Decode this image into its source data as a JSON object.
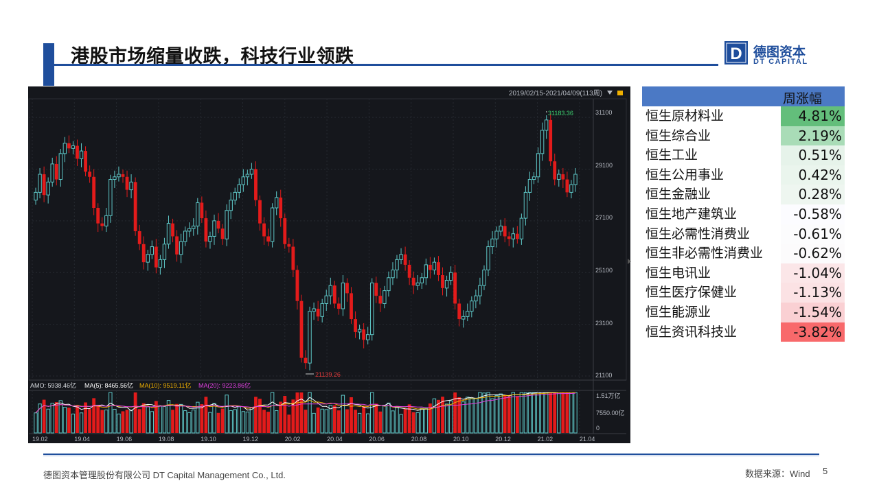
{
  "header": {
    "title": "港股市场缩量收跌，科技行业领跌"
  },
  "logo": {
    "cn": "德图资本",
    "en": "DT CAPITAL",
    "mark": "D"
  },
  "chart": {
    "date_range": "2019/02/15-2021/04/09(113周)",
    "max_label": "31183.36",
    "min_label": "21139.26",
    "price_ticks": [
      "31100",
      "29100",
      "27100",
      "25100",
      "23100",
      "21100"
    ],
    "amo_label": "AMO: 5938.46亿",
    "ma5_label": "MA(5): 8465.56亿",
    "ma10_label": "MA(10): 9519.11亿",
    "ma20_label": "MA(20): 9223.86亿",
    "vol_ticks": [
      "1.51万亿",
      "7550.00亿",
      "0"
    ],
    "x_labels": [
      "19.02",
      "19.04",
      "19.06",
      "19.08",
      "19.10",
      "19.12",
      "20.02",
      "20.04",
      "20.06",
      "20.08",
      "20.10",
      "20.12",
      "21.02",
      "21.04"
    ],
    "colors": {
      "up": "#5ec7c7",
      "down": "#e31b1b",
      "bg": "#15171c",
      "ma5": "#ffffff",
      "ma10": "#f0b000",
      "ma20": "#e040e0"
    }
  },
  "chart_data": {
    "type": "candlestick",
    "title": "",
    "ylim": [
      21100,
      31500
    ],
    "closes": [
      28200,
      28900,
      28100,
      28600,
      29300,
      28700,
      29700,
      30100,
      29900,
      30000,
      29500,
      29800,
      29000,
      28800,
      27600,
      27000,
      26900,
      27300,
      28700,
      28800,
      28900,
      28800,
      28300,
      28600,
      26700,
      26200,
      25500,
      25800,
      26100,
      25300,
      25600,
      26200,
      27000,
      26500,
      25800,
      26300,
      26700,
      26800,
      26900,
      27800,
      27200,
      26300,
      26500,
      27100,
      26800,
      26400,
      27500,
      27900,
      28200,
      28500,
      28800,
      28900,
      29100,
      27900,
      27000,
      26500,
      26300,
      27600,
      28000,
      27200,
      26200,
      26100,
      25200,
      24000,
      21800,
      21600,
      23600,
      23700,
      23400,
      23900,
      24200,
      24600,
      23900,
      23700,
      24700,
      24300,
      23300,
      22800,
      22900,
      22500,
      22700,
      24700,
      24200,
      23900,
      24400,
      24900,
      25200,
      25600,
      25800,
      25400,
      24900,
      24600,
      24700,
      24900,
      25400,
      25200,
      25500,
      25000,
      24500,
      24800,
      25100,
      23900,
      23300,
      23400,
      23600,
      24000,
      24200,
      24600,
      25200,
      26100,
      26400,
      26700,
      26900,
      26500,
      26400,
      26600,
      26400,
      27200,
      28200,
      28700,
      28800,
      29700,
      30600,
      31000,
      29400,
      28700,
      28900,
      28700,
      28200,
      28500,
      28900
    ],
    "volume_ticks": [
      "1.51万亿",
      "7550.00亿",
      "0"
    ],
    "series_labels": [
      "AMO: 5938.46亿",
      "MA(5): 8465.56亿",
      "MA(10): 9519.11亿",
      "MA(20): 9223.86亿"
    ]
  },
  "table": {
    "header": "周涨幅",
    "rows": [
      {
        "name": "恒生原材料业",
        "value": "4.81%",
        "color": "#63be7b"
      },
      {
        "name": "恒生综合业",
        "value": "2.19%",
        "color": "#a9dcb7"
      },
      {
        "name": "恒生工业",
        "value": "0.51%",
        "color": "#e6f3ea"
      },
      {
        "name": "恒生公用事业",
        "value": "0.42%",
        "color": "#eaf5ed"
      },
      {
        "name": "恒生金融业",
        "value": "0.28%",
        "color": "#eef6f0"
      },
      {
        "name": "恒生地产建筑业",
        "value": "-0.58%",
        "color": "#fcfcff"
      },
      {
        "name": "恒生必需性消费业",
        "value": "-0.61%",
        "color": "#fcfcfd"
      },
      {
        "name": "恒生非必需性消费业",
        "value": "-0.62%",
        "color": "#fcfbfc"
      },
      {
        "name": "恒生电讯业",
        "value": "-1.04%",
        "color": "#fbe6e8"
      },
      {
        "name": "恒生医疗保健业",
        "value": "-1.13%",
        "color": "#fbe2e4"
      },
      {
        "name": "恒生能源业",
        "value": "-1.54%",
        "color": "#fad0d3"
      },
      {
        "name": "恒生资讯科技业",
        "value": "-3.82%",
        "color": "#f8696b"
      }
    ]
  },
  "footer": {
    "company": "德图资本管理股份有限公司  DT Capital Management Co., Ltd.",
    "source": "数据来源：Wind",
    "page": "5"
  }
}
